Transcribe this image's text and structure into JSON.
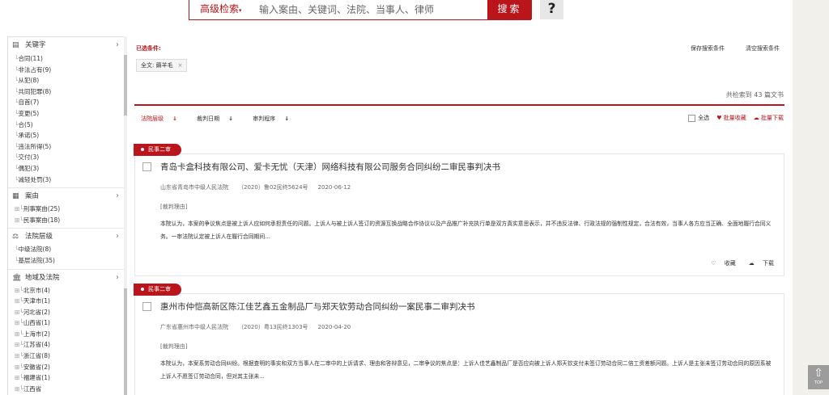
{
  "search": {
    "advanced_label": "高级检索",
    "placeholder": "输入案由、关键词、法院、当事人、律师",
    "button_label": "搜索",
    "help_label": "?"
  },
  "sidebar": {
    "sections": [
      {
        "title": "关键字",
        "icon": "document-icon",
        "items": [
          "合同(11)",
          "非法占有(9)",
          "从犯(8)",
          "共同犯罪(8)",
          "自首(7)",
          "变更(5)",
          "合(5)",
          "承诺(5)",
          "违法所得(5)",
          "交付(3)",
          "偶犯(3)",
          "减轻处罚(3)"
        ]
      },
      {
        "title": "案由",
        "icon": "list-icon",
        "items": [
          "刑事案由(25)",
          "民事案由(18)"
        ]
      },
      {
        "title": "法院层级",
        "icon": "scales-icon",
        "items": [
          "中级法院(8)",
          "基层法院(35)"
        ]
      },
      {
        "title": "地域及法院",
        "icon": "courthouse-icon",
        "items": [
          "北京市(4)",
          "天津市(1)",
          "河北省(2)",
          "山西省(1)",
          "上海市(2)",
          "江苏省(4)",
          "浙江省(8)",
          "安徽省(2)",
          "福建省(1)",
          "江西省"
        ]
      }
    ]
  },
  "conditions": {
    "label": "已选条件:",
    "tag": "全文: 薅羊毛",
    "tag_close": "×",
    "save_label": "保存搜索条件",
    "clear_label": "清空搜索条件"
  },
  "results": {
    "count_prefix": "共检索到",
    "count": "43",
    "count_suffix": "篇文书"
  },
  "sort": {
    "court_level": "法院层级",
    "judge_date": "裁判日期",
    "procedure": "审判程序"
  },
  "bulk": {
    "select_all": "全选",
    "bulk_collect": "批量收藏",
    "bulk_download": "批量下载"
  },
  "cases": [
    {
      "badge": "民事二审",
      "title": "青岛卡盒科技有限公司、爱卡无忧（天津）网络科技有限公司服务合同纠纷二审民事判决书",
      "court": "山东省青岛市中级人民法院",
      "case_no": "（2020）鲁02民终5624号",
      "date": "2020-06-12",
      "reason_label": "[裁判理由]",
      "summary": "本院认为，本案的争议焦点是被上诉人应如何承担责任的问题。上诉人与被上诉人签订的资源互换战略合作协议以及产品推广补充执行单是双方真实意思表示，并不违反法律、行政法规的强制性规定，合法有效，当事人各方应当正确、全面地履行合同义务。一审法院认定被上诉人在履行合同期间...",
      "collect": "收藏",
      "download": "下载"
    },
    {
      "badge": "民事二审",
      "title": "惠州市仲恺高新区陈江佳艺鑫五金制品厂与郑天钦劳动合同纠纷一案民事二审判决书",
      "court": "广东省惠州市中级人民法院",
      "case_no": "（2020）粤13民终1303号",
      "date": "2020-04-20",
      "reason_label": "[裁判理由]",
      "summary": "本院认为，本案系劳动合同纠纷。根据查明的事实和双方当事人在二审中的上诉请求、理由和答辩意见，二审争议的焦点是：上诉人佳艺鑫制品厂是否应向被上诉人郑天钦支付未签订劳动合同二倍工资差额问题。上诉人是主张未签订劳动合同的原因系被上诉人不愿签订劳动合同，但对其主张未...",
      "collect": "收藏",
      "download": "下载"
    }
  ],
  "back_to_top": "TOP"
}
